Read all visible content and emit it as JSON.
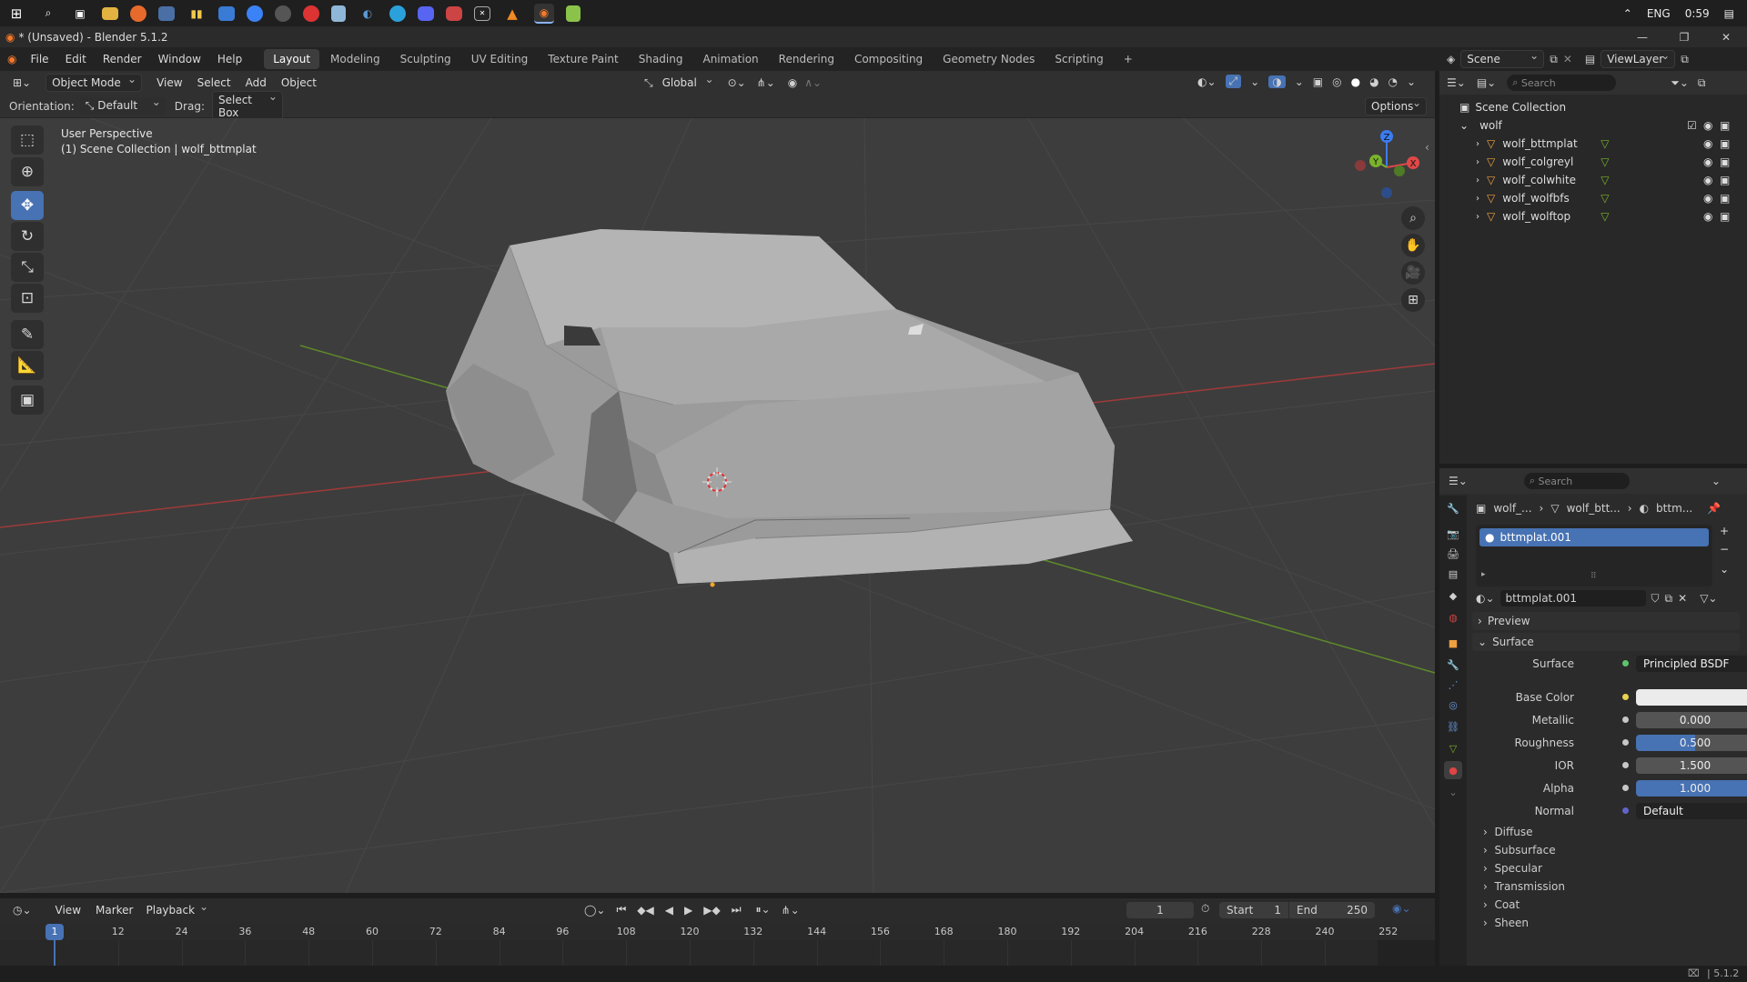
{
  "taskbar": {
    "language": "ENG",
    "time": "0:59"
  },
  "window": {
    "title": "* (Unsaved) - Blender 5.1.2"
  },
  "menu": {
    "items": [
      "File",
      "Edit",
      "Render",
      "Window",
      "Help"
    ],
    "workspaces": [
      "Layout",
      "Modeling",
      "Sculpting",
      "UV Editing",
      "Texture Paint",
      "Shading",
      "Animation",
      "Rendering",
      "Compositing",
      "Geometry Nodes",
      "Scripting"
    ],
    "active_workspace": "Layout",
    "add_tab": "+",
    "scene": "Scene",
    "view_layer": "ViewLayer"
  },
  "viewport_header": {
    "mode": "Object Mode",
    "menus": [
      "View",
      "Select",
      "Add",
      "Object"
    ],
    "transform_orientation": "Global"
  },
  "tool_header": {
    "orientation_label": "Orientation:",
    "orientation_value": "Default",
    "drag_label": "Drag:",
    "drag_value": "Select Box",
    "options": "Options"
  },
  "viewport": {
    "perspective": "User Perspective",
    "collection_info": "(1) Scene Collection | wolf_bttmplat",
    "gizmo_axes": {
      "z": "Z",
      "y": "Y",
      "x": "X"
    }
  },
  "outliner": {
    "search_placeholder": "Search",
    "root": "Scene Collection",
    "collection": "wolf",
    "objects": [
      "wolf_bttmplat",
      "wolf_colgreyl",
      "wolf_colwhite",
      "wolf_wolfbfs",
      "wolf_wolftop"
    ]
  },
  "properties": {
    "search_placeholder": "Search",
    "breadcrumb": [
      "wolf_...",
      "wolf_btt...",
      "bttm..."
    ],
    "material_slot": "bttmplat.001",
    "material_name": "bttmplat.001",
    "panels": {
      "preview": "Preview",
      "surface": "Surface"
    },
    "surface": {
      "surface_label": "Surface",
      "surface_value": "Principled BSDF",
      "base_color_label": "Base Color",
      "metallic_label": "Metallic",
      "metallic_value": "0.000",
      "roughness_label": "Roughness",
      "roughness_value": "0.500",
      "ior_label": "IOR",
      "ior_value": "1.500",
      "alpha_label": "Alpha",
      "alpha_value": "1.000",
      "normal_label": "Normal",
      "normal_value": "Default"
    },
    "subpanels": [
      "Diffuse",
      "Subsurface",
      "Specular",
      "Transmission",
      "Coat",
      "Sheen"
    ]
  },
  "timeline": {
    "menus": [
      "View",
      "Marker",
      "Playback"
    ],
    "current_frame": "1",
    "start_label": "Start",
    "start_value": "1",
    "end_label": "End",
    "end_value": "250",
    "frame_marker": "1",
    "ticks": [
      "12",
      "24",
      "36",
      "48",
      "60",
      "72",
      "84",
      "96",
      "108",
      "120",
      "132",
      "144",
      "156",
      "168",
      "180",
      "192",
      "204",
      "216",
      "228",
      "240",
      "252"
    ]
  },
  "status": {
    "version": "5.1.2"
  },
  "colors": {
    "accent": "#4772b3",
    "viewport_bg": "#3d3d3d",
    "axis_x": "#e04848",
    "axis_y": "#7ab32b",
    "axis_z": "#3b7cf0"
  }
}
